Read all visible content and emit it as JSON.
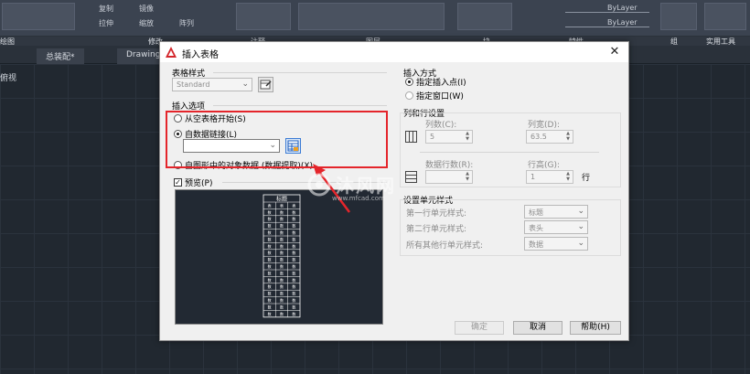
{
  "ribbon": {
    "panels": {
      "draw": "绘图",
      "modify": "修改",
      "annotation": "注释",
      "layers": "图层",
      "block": "块",
      "properties": "特性",
      "groups": "组",
      "utilities": "实用工具"
    },
    "layer_combo_1": "ByLayer",
    "layer_combo_2": "ByLayer",
    "modify_labels": [
      "复制",
      "镜像",
      "拉伸",
      "缩放",
      "阵列"
    ]
  },
  "doc_tabs": [
    "总装配*",
    "Drawing"
  ],
  "view_label": "俯视",
  "dialog": {
    "title": "插入表格",
    "table_style": {
      "label": "表格样式",
      "value": "Standard"
    },
    "insert_options": {
      "label": "插入选项",
      "options": [
        {
          "label": "从空表格开始(S)",
          "selected": false
        },
        {
          "label": "自数据链接(L)",
          "selected": true
        },
        {
          "label": "自图形中的对象数据 (数据提取)(X)",
          "selected": false
        }
      ],
      "data_link_value": ""
    },
    "preview": {
      "label": "预览(P)",
      "checked": true,
      "table_title": "标题",
      "header_cell": "表头",
      "data_cell": "数据"
    },
    "insertion": {
      "label": "插入方式",
      "options": [
        {
          "label": "指定插入点(I)",
          "selected": true
        },
        {
          "label": "指定窗口(W)",
          "selected": false
        }
      ]
    },
    "columns_rows": {
      "label": "列和行设置",
      "columns_label": "列数(C):",
      "columns_value": "5",
      "col_width_label": "列宽(D):",
      "col_width_value": "63.5",
      "data_rows_label": "数据行数(R):",
      "data_rows_value": "",
      "row_height_label": "行高(G):",
      "row_height_value": "1",
      "row_unit": "行"
    },
    "cell_styles": {
      "label": "设置单元样式",
      "row1_label": "第一行单元样式:",
      "row1_value": "标题",
      "row2_label": "第二行单元样式:",
      "row2_value": "表头",
      "other_label": "所有其他行单元样式:",
      "other_value": "数据"
    },
    "buttons": {
      "ok": "确定",
      "cancel": "取消",
      "help": "帮助(H)"
    }
  },
  "watermark": {
    "brand": "沐风网",
    "url": "www.mfcad.com"
  },
  "colors": {
    "accent_red": "#e4252b",
    "canvas_bg": "#212830",
    "ribbon_bg": "#3b4350"
  }
}
